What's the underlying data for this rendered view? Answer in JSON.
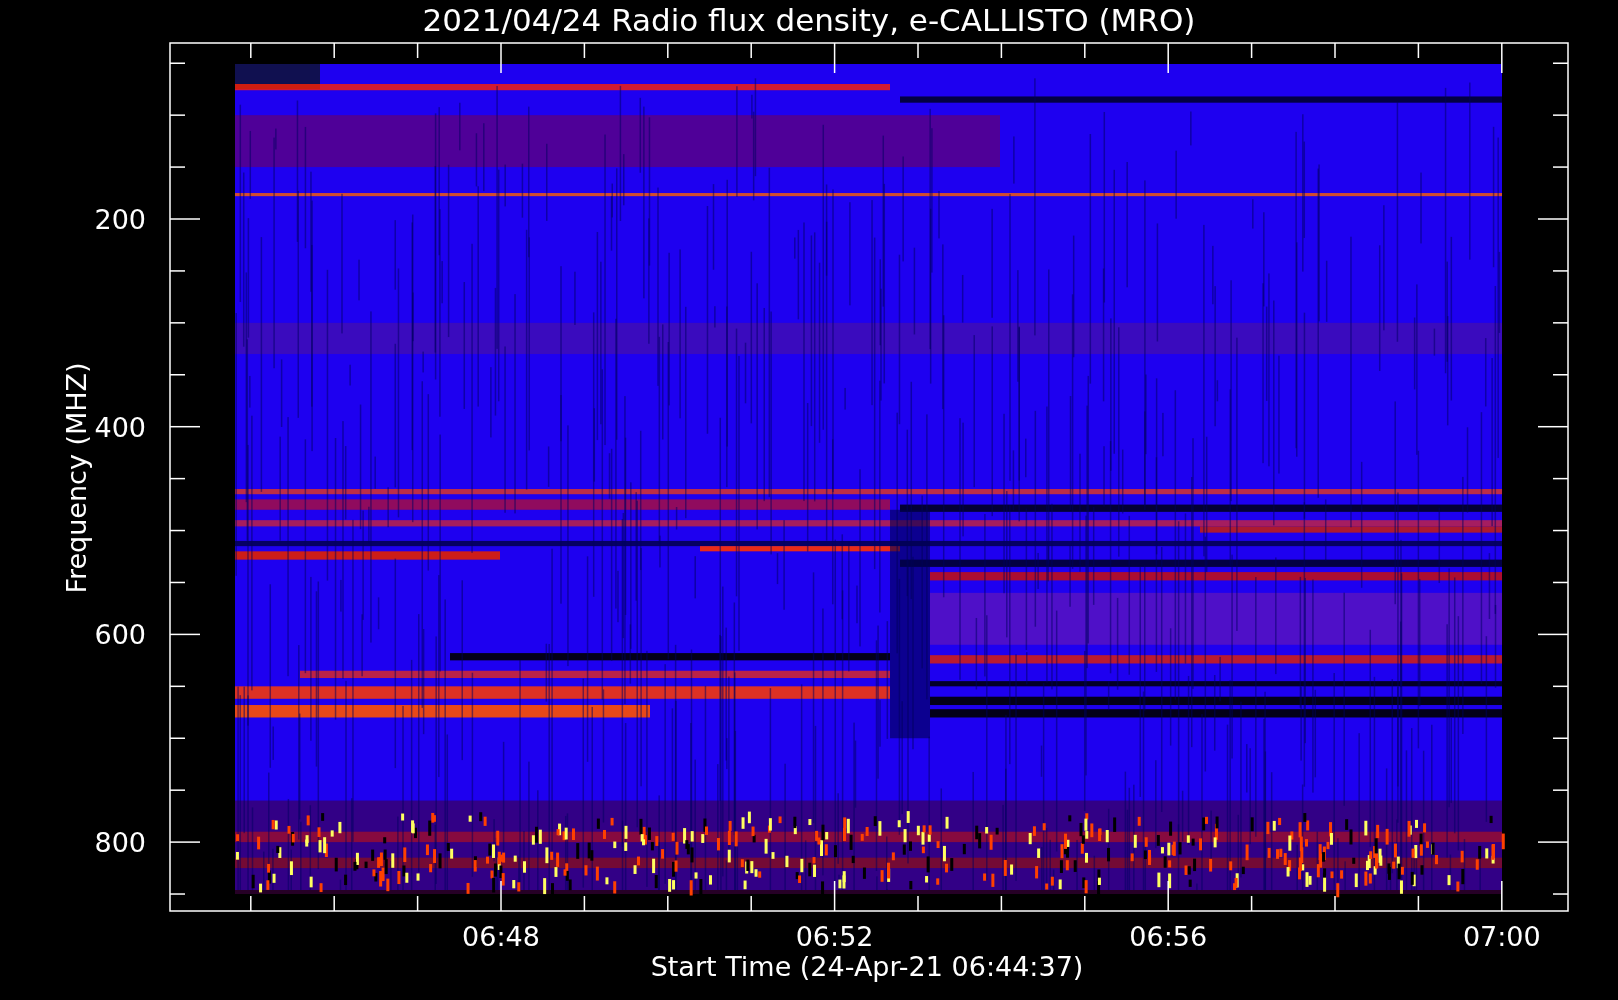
{
  "plot": {
    "title": "2021/04/24  Radio flux density, e-CALLISTO (MRO)",
    "ylabel": "Frequency (MHZ)",
    "xlabel": "Start Time (24-Apr-21 06:44:37)",
    "yticks": [
      "200",
      "400",
      "600",
      "800"
    ],
    "xticks": [
      "06:48",
      "06:52",
      "06:56",
      "07:00"
    ]
  }
}
